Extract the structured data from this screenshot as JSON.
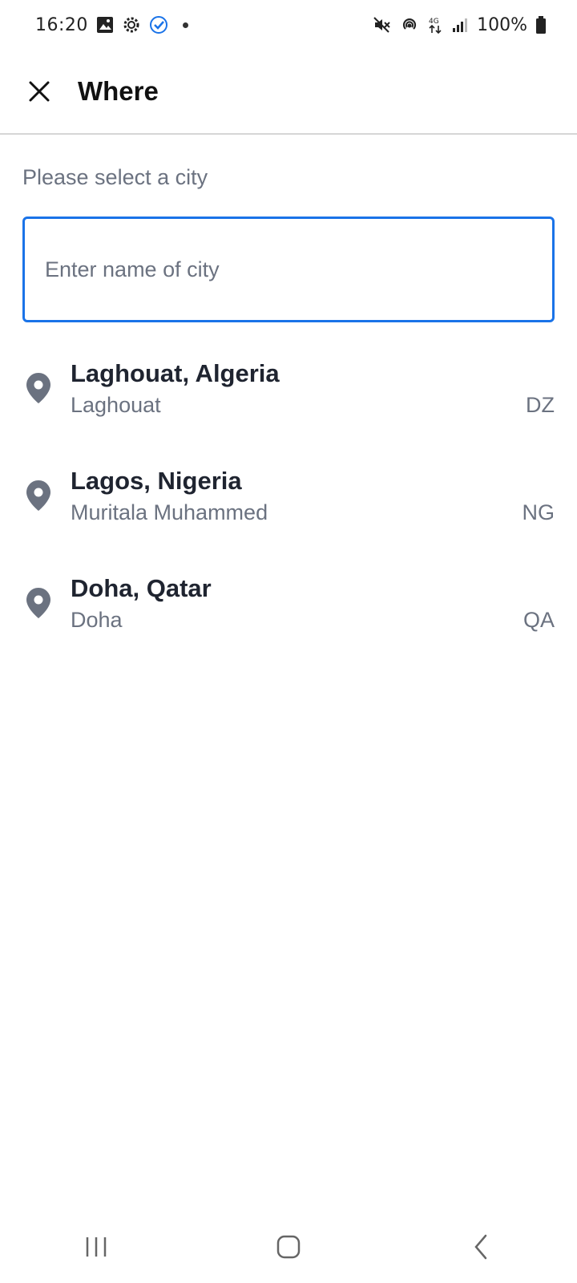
{
  "status_bar": {
    "time": "16:20",
    "battery": "100%",
    "icons_left": [
      "image-icon",
      "settings-icon",
      "check-circle-icon",
      "dot-icon"
    ],
    "icons_right": [
      "mute-icon",
      "hotspot-icon",
      "network-4g-icon",
      "signal-icon",
      "battery-icon"
    ]
  },
  "app_bar": {
    "title": "Where",
    "close_icon": "close-icon"
  },
  "prompt": "Please select a city",
  "search": {
    "placeholder": "Enter name of city",
    "value": ""
  },
  "results": [
    {
      "title": "Laghouat, Algeria",
      "subtitle": "Laghouat",
      "code": "DZ"
    },
    {
      "title": "Lagos, Nigeria",
      "subtitle": "Muritala Muhammed",
      "code": "NG"
    },
    {
      "title": "Doha, Qatar",
      "subtitle": "Doha",
      "code": "QA"
    }
  ],
  "nav_bar": {
    "buttons": [
      "recent-apps-icon",
      "home-icon",
      "back-icon"
    ]
  },
  "colors": {
    "accent": "#1a73e8",
    "pin": "#6b7280",
    "title_text": "#1f2430",
    "secondary_text": "#6b7280"
  }
}
